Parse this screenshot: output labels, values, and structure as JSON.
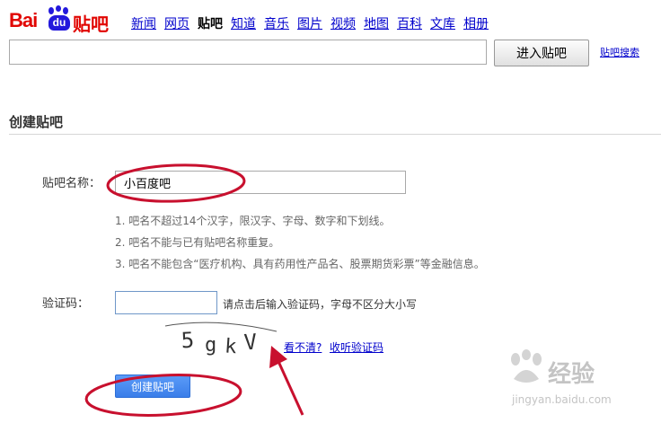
{
  "logo": {
    "bai": "Bai",
    "du": "du",
    "tieba": "贴吧"
  },
  "nav": [
    {
      "label": "新闻",
      "active": false
    },
    {
      "label": "网页",
      "active": false
    },
    {
      "label": "贴吧",
      "active": true
    },
    {
      "label": "知道",
      "active": false
    },
    {
      "label": "音乐",
      "active": false
    },
    {
      "label": "图片",
      "active": false
    },
    {
      "label": "视频",
      "active": false
    },
    {
      "label": "地图",
      "active": false
    },
    {
      "label": "百科",
      "active": false
    },
    {
      "label": "文库",
      "active": false
    },
    {
      "label": "相册",
      "active": false
    }
  ],
  "search": {
    "value": "",
    "button_label": "进入贴吧",
    "link_label": "贴吧搜索"
  },
  "section": {
    "title": "创建贴吧"
  },
  "form": {
    "name_label": "贴吧名称：",
    "name_value": "小百度吧",
    "rules": [
      "1. 吧名不超过14个汉字，限汉字、字母、数字和下划线。",
      "2. 吧名不能与已有贴吧名称重复。",
      "3. 吧名不能包含“医疗机构、具有药用性产品名、股票期货彩票”等金融信息。"
    ],
    "captcha_label": "验证码：",
    "captcha_value": "",
    "captcha_hint": "请点击后输入验证码，字母不区分大小写",
    "captcha_text": "5gkV",
    "cant_see": "看不清?",
    "listen": "收听验证码",
    "create_button": "创建贴吧"
  },
  "colors": {
    "brand_red": "#e10602",
    "brand_blue": "#2319dc",
    "link_blue": "#0000cc",
    "annotation_red": "#c8102e",
    "button_blue": "#3a7ee9"
  },
  "watermark": {
    "brand": "经验",
    "url": "jingyan.baidu.com"
  }
}
